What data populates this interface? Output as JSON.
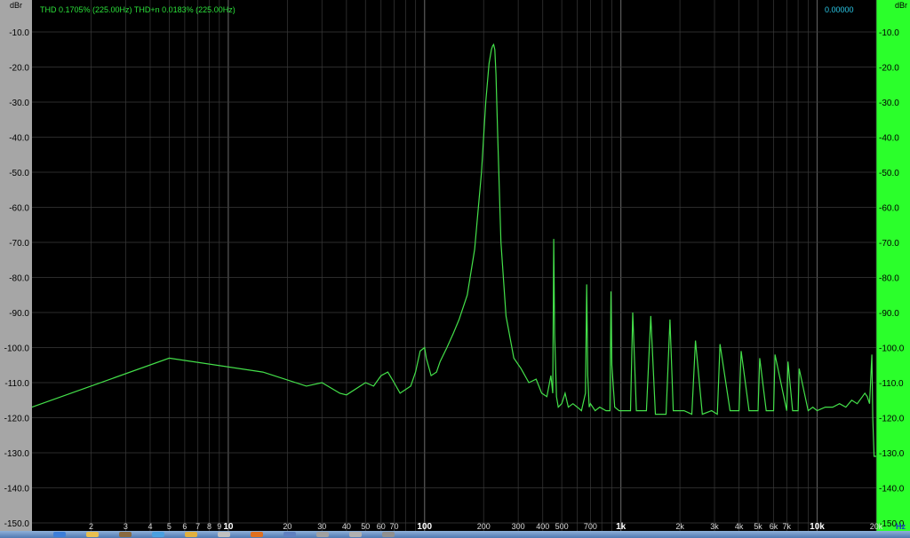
{
  "header": {
    "thd_readout": "THD 0.1705% (225.00Hz) THD+n 0.0183% (225.00Hz)",
    "cursor_readout": "0.00000"
  },
  "colors": {
    "trace": "#44e04a",
    "plot_background": "#000000",
    "left_panel": "#a6a6a6",
    "right_panel": "#2bff2b",
    "readout_text": "#2be03a",
    "cursor_text": "#2bc8e8",
    "grid": "#3a3a3a"
  },
  "taskbar": {
    "icons": [
      "start-icon",
      "explorer-icon",
      "media-icon",
      "browser-icon",
      "folder-icon",
      "app-icon",
      "firefox-icon",
      "app-icon",
      "app-icon",
      "app-icon",
      "app-icon"
    ]
  },
  "chart_data": {
    "type": "line",
    "title": "",
    "xlabel": "Hz",
    "ylabel": "dBr",
    "x_scale": "log",
    "xlim": [
      1,
      20000
    ],
    "ylim": [
      -150,
      -10
    ],
    "grid": true,
    "x_tick_labels": [
      {
        "value": 2,
        "label": "2",
        "bold": false
      },
      {
        "value": 3,
        "label": "3",
        "bold": false
      },
      {
        "value": 4,
        "label": "4",
        "bold": false
      },
      {
        "value": 5,
        "label": "5",
        "bold": false
      },
      {
        "value": 6,
        "label": "6",
        "bold": false
      },
      {
        "value": 7,
        "label": "7",
        "bold": false
      },
      {
        "value": 8,
        "label": "8",
        "bold": false
      },
      {
        "value": 9,
        "label": "9",
        "bold": false
      },
      {
        "value": 10,
        "label": "10",
        "bold": true
      },
      {
        "value": 20,
        "label": "20",
        "bold": false
      },
      {
        "value": 30,
        "label": "30",
        "bold": false
      },
      {
        "value": 40,
        "label": "40",
        "bold": false
      },
      {
        "value": 50,
        "label": "50",
        "bold": false
      },
      {
        "value": 60,
        "label": "60",
        "bold": false
      },
      {
        "value": 70,
        "label": "70",
        "bold": false
      },
      {
        "value": 100,
        "label": "100",
        "bold": true
      },
      {
        "value": 200,
        "label": "200",
        "bold": false
      },
      {
        "value": 300,
        "label": "300",
        "bold": false
      },
      {
        "value": 400,
        "label": "400",
        "bold": false
      },
      {
        "value": 500,
        "label": "500",
        "bold": false
      },
      {
        "value": 700,
        "label": "700",
        "bold": false
      },
      {
        "value": 1000,
        "label": "1k",
        "bold": true
      },
      {
        "value": 2000,
        "label": "2k",
        "bold": false
      },
      {
        "value": 3000,
        "label": "3k",
        "bold": false
      },
      {
        "value": 4000,
        "label": "4k",
        "bold": false
      },
      {
        "value": 5000,
        "label": "5k",
        "bold": false
      },
      {
        "value": 6000,
        "label": "6k",
        "bold": false
      },
      {
        "value": 7000,
        "label": "7k",
        "bold": false
      },
      {
        "value": 10000,
        "label": "10k",
        "bold": true
      },
      {
        "value": 20000,
        "label": "20k",
        "bold": false
      }
    ],
    "y_tick_labels": [
      "-10.0",
      "-20.0",
      "-30.0",
      "-40.0",
      "-50.0",
      "-60.0",
      "-70.0",
      "-80.0",
      "-90.0",
      "-100.0",
      "-110.0",
      "-120.0",
      "-130.0",
      "-140.0",
      "-150.0"
    ],
    "y_tick_values": [
      -10,
      -20,
      -30,
      -40,
      -50,
      -60,
      -70,
      -80,
      -90,
      -100,
      -110,
      -120,
      -130,
      -140,
      -150
    ],
    "y_labels_right": [
      "-10.0",
      "-20.0",
      "-30.0",
      "-40.0",
      "-50.0",
      "-60.0",
      "-70.0",
      "-80.0",
      "-90.0",
      "-100.0",
      "-110.0",
      "-120.0",
      "-130.0",
      "-140.0",
      "-150.0"
    ],
    "series": [
      {
        "values_x": [
          1,
          5,
          15,
          25,
          30,
          37,
          40,
          47,
          50,
          55,
          60,
          65,
          70,
          75,
          85,
          90,
          95,
          100,
          102,
          108,
          115,
          120,
          130,
          140,
          150,
          165,
          180,
          195,
          205,
          213,
          219,
          222,
          225,
          228,
          231,
          236,
          245,
          260,
          285,
          310,
          340,
          370,
          395,
          420,
          440,
          450,
          455,
          460,
          470,
          480,
          500,
          520,
          540,
          570,
          600,
          630,
          660,
          670,
          678,
          690,
          700,
          740,
          780,
          840,
          880,
          890,
          900,
          930,
          980,
          1050,
          1120,
          1150,
          1200,
          1350,
          1420,
          1500,
          1700,
          1780,
          1850,
          2100,
          2300,
          2400,
          2600,
          2900,
          3100,
          3200,
          3600,
          4000,
          4100,
          4500,
          5000,
          5100,
          5500,
          6000,
          6100,
          7000,
          7100,
          7500,
          8000,
          8100,
          9000,
          9500,
          10000,
          11000,
          12000,
          13000,
          14000,
          15000,
          16000,
          17000,
          17500,
          18000,
          18500,
          19000,
          19200,
          19500,
          20000
        ],
        "values_y": [
          -117,
          -103,
          -107,
          -111,
          -110,
          -113,
          -113.5,
          -111,
          -110,
          -111,
          -108,
          -107,
          -110,
          -113,
          -111,
          -107,
          -101,
          -100,
          -103,
          -108,
          -107,
          -104,
          -100,
          -96,
          -92,
          -85,
          -72,
          -50,
          -30,
          -19,
          -15,
          -14,
          -13.6,
          -15,
          -22,
          -40,
          -70,
          -91,
          -103,
          -106,
          -110,
          -109,
          -113,
          -114,
          -108,
          -113,
          -69,
          -96,
          -114,
          -117,
          -116,
          -113,
          -117,
          -116,
          -117,
          -118,
          -113,
          -82,
          -108,
          -117,
          -116,
          -118,
          -117,
          -118,
          -118,
          -84,
          -105,
          -117,
          -118,
          -118,
          -118,
          -90,
          -118,
          -118,
          -91,
          -119,
          -119,
          -92,
          -118,
          -118,
          -119,
          -98,
          -119,
          -118,
          -119,
          -99,
          -118,
          -118,
          -101,
          -118,
          -118,
          -103,
          -118,
          -118,
          -102,
          -118,
          -104,
          -118,
          -118,
          -106,
          -118,
          -117,
          -118,
          -117,
          -117,
          -116,
          -117,
          -115,
          -116,
          -114,
          -113,
          -114,
          -116,
          -102,
          -120,
          -131,
          -131
        ]
      }
    ]
  }
}
